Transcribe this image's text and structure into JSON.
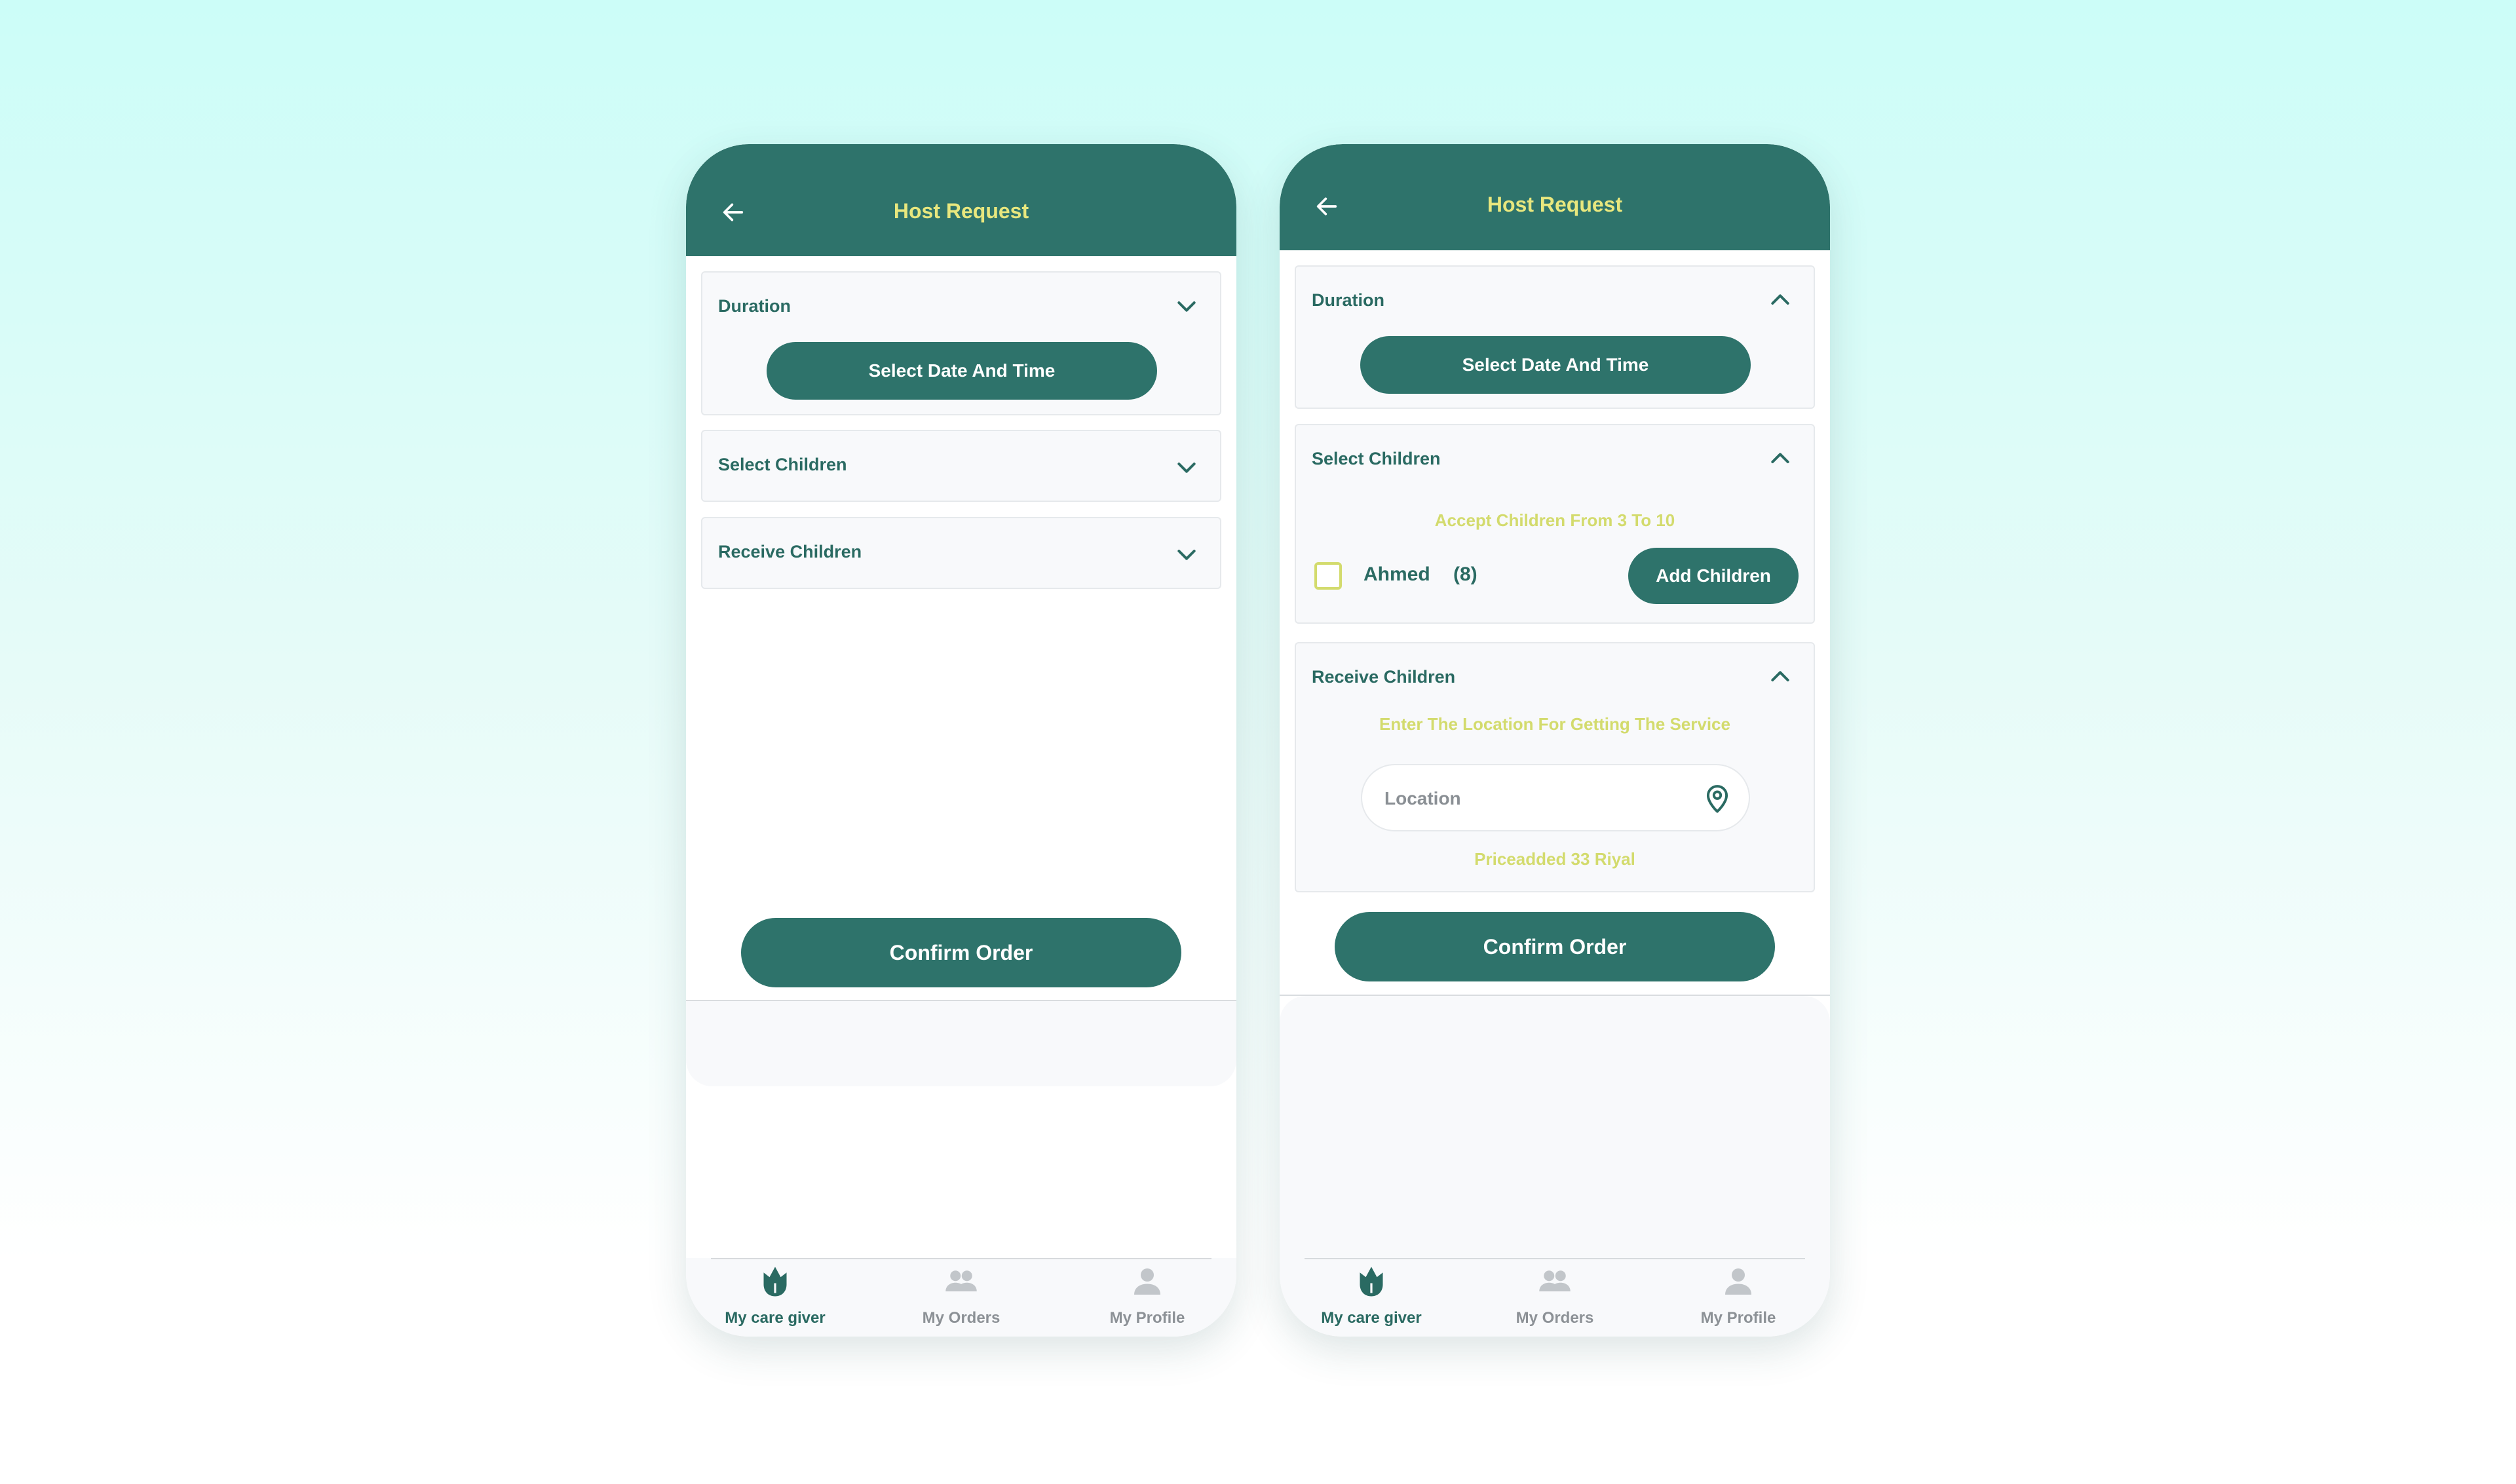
{
  "colors": {
    "primary": "#2e736b",
    "title_accent": "#e8e77e",
    "hint_accent": "#d3db6d",
    "page_bg": "#ccfdf8"
  },
  "screens": [
    {
      "header": {
        "title": "Host Request",
        "back_icon": "arrow-left-icon"
      },
      "sections": {
        "duration": {
          "title": "Duration",
          "expanded": true,
          "button": "Select Date And Time"
        },
        "select_children": {
          "title": "Select Children",
          "expanded": false
        },
        "receive_children": {
          "title": "Receive Children",
          "expanded": false
        }
      },
      "confirm_button": "Confirm Order",
      "nav": [
        {
          "label": "My care giver",
          "icon": "tulip-icon",
          "active": true
        },
        {
          "label": "My Orders",
          "icon": "people-icon",
          "active": false
        },
        {
          "label": "My Profile",
          "icon": "person-icon",
          "active": false
        }
      ]
    },
    {
      "header": {
        "title": "Host Request",
        "back_icon": "arrow-left-icon"
      },
      "sections": {
        "duration": {
          "title": "Duration",
          "expanded": true,
          "button": "Select Date And Time"
        },
        "select_children": {
          "title": "Select Children",
          "expanded": true,
          "hint": "Accept Children From 3 To 10",
          "child": {
            "name": "Ahmed",
            "age": "(8)",
            "checked": false
          },
          "add_button": "Add Children"
        },
        "receive_children": {
          "title": "Receive Children",
          "expanded": true,
          "hint": "Enter The Location For Getting The Service",
          "location_placeholder": "Location",
          "price_added": "Priceadded 33 Riyal"
        }
      },
      "confirm_button": "Confirm Order",
      "nav": [
        {
          "label": "My care giver",
          "icon": "tulip-icon",
          "active": true
        },
        {
          "label": "My Orders",
          "icon": "people-icon",
          "active": false
        },
        {
          "label": "My Profile",
          "icon": "person-icon",
          "active": false
        }
      ]
    }
  ]
}
